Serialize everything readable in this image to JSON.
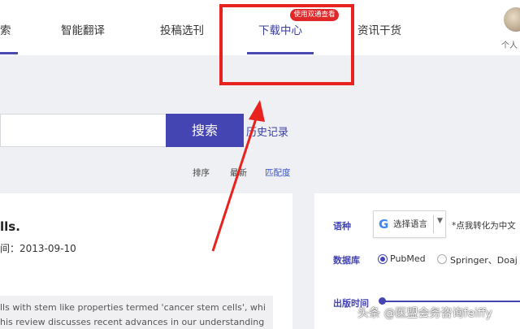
{
  "nav": {
    "items": [
      {
        "label": "索"
      },
      {
        "label": "智能翻译"
      },
      {
        "label": "投稿选刊"
      },
      {
        "label": "下载中心"
      },
      {
        "label": "资讯干货"
      }
    ],
    "active_index": 3,
    "badge": "使用双通查看",
    "user_label": "个人"
  },
  "search": {
    "button_label": "搜索",
    "history_label": "历史记录"
  },
  "sort": {
    "label": "排序",
    "options": [
      "最新",
      "匹配度"
    ],
    "active": "匹配度"
  },
  "result": {
    "title": "lls.",
    "date": "间：2013-09-10",
    "abstract_lines": [
      "lls with stem like properties termed 'cancer stem cells', whi",
      "his review discusses recent advances in our understanding"
    ]
  },
  "filters": {
    "language_label": "语种",
    "language_select": "选择语言",
    "language_hint": "*点我转化为中文",
    "database_label": "数据库",
    "databases": [
      {
        "label": "PubMed",
        "checked": true
      },
      {
        "label": "Springer、Doaj",
        "checked": false
      }
    ],
    "pubtime_label": "出版时间"
  },
  "icons": {
    "google": "google-g-icon",
    "caret": "caret-down-icon"
  },
  "watermark": "头条 @医盟会务咨询feiffy",
  "colors": {
    "accent": "#4444b2",
    "annotation_red": "#e8221f"
  }
}
